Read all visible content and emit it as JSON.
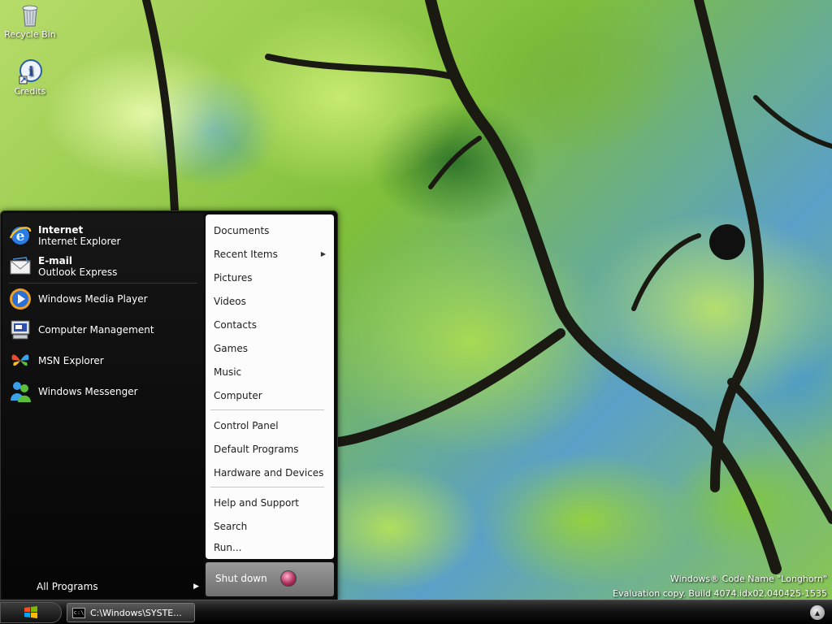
{
  "desktop": {
    "icons": [
      {
        "label": "Recycle Bin",
        "icon": "recycle-bin-icon"
      },
      {
        "label": "Credits",
        "icon": "info-icon"
      }
    ],
    "watermark_line1": "Windows® Code Name \"Longhorn\"",
    "watermark_line2": "Evaluation copy. Build 4074.idx02.040425-1535"
  },
  "start_menu": {
    "pinned": [
      {
        "title": "Internet",
        "subtitle": "Internet Explorer",
        "icon": "internet-explorer-icon"
      },
      {
        "title": "E-mail",
        "subtitle": "Outlook Express",
        "icon": "outlook-express-icon"
      }
    ],
    "programs": [
      {
        "label": "Windows Media Player",
        "icon": "media-player-icon"
      },
      {
        "label": "Computer Management",
        "icon": "computer-management-icon"
      },
      {
        "label": "MSN Explorer",
        "icon": "msn-butterfly-icon"
      },
      {
        "label": "Windows Messenger",
        "icon": "messenger-icon"
      }
    ],
    "all_programs_label": "All Programs",
    "right_items": [
      {
        "label": "Documents"
      },
      {
        "label": "Recent Items",
        "has_submenu": true
      },
      {
        "label": "Pictures"
      },
      {
        "label": "Videos"
      },
      {
        "label": "Contacts"
      },
      {
        "label": "Games"
      },
      {
        "label": "Music"
      },
      {
        "label": "Computer"
      },
      {
        "label": "Control Panel"
      },
      {
        "label": "Default Programs"
      },
      {
        "label": "Hardware and Devices"
      },
      {
        "label": "Help and Support"
      },
      {
        "label": "Search"
      },
      {
        "label": "Run..."
      }
    ],
    "shutdown_label": "Shut down"
  },
  "taskbar": {
    "task_label": "C:\\Windows\\SYSTE...",
    "task_icon_text": "c:\\"
  },
  "colors": {
    "menu_dark": "#0b0b0b",
    "menu_light": "#fcfcfc",
    "shutdown_button": "#b03060"
  }
}
